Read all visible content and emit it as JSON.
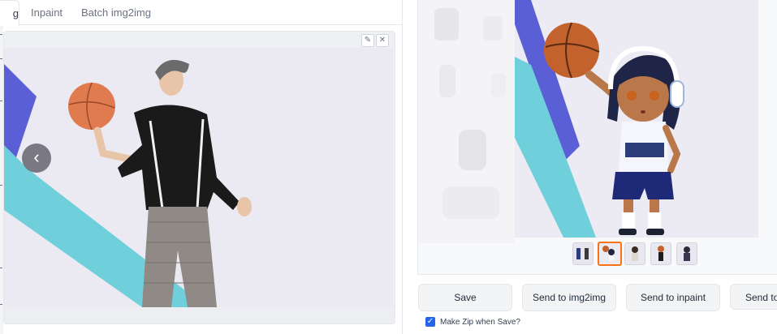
{
  "tabs": {
    "active_partial": "g",
    "items": [
      "Inpaint",
      "Batch img2img"
    ]
  },
  "image_editor": {
    "edit_glyph": "✎",
    "close_glyph": "✕",
    "prev_glyph": "‹"
  },
  "output": {
    "thumbnail_count": 5,
    "selected_thumbnail_index": 1
  },
  "buttons": {
    "save": "Save",
    "send_to_img2img": "Send to img2img",
    "send_to_inpaint": "Send to inpaint",
    "send_to_extras_partial": "Send to"
  },
  "make_zip": {
    "label": "Make Zip when Save?",
    "checked": true,
    "check_glyph": "✓"
  },
  "colors": {
    "accent_blue": "#2563eb",
    "selected_thumb": "#f97316",
    "stripe_purple": "#5b5fd6",
    "stripe_cyan": "#6fd0dc"
  }
}
